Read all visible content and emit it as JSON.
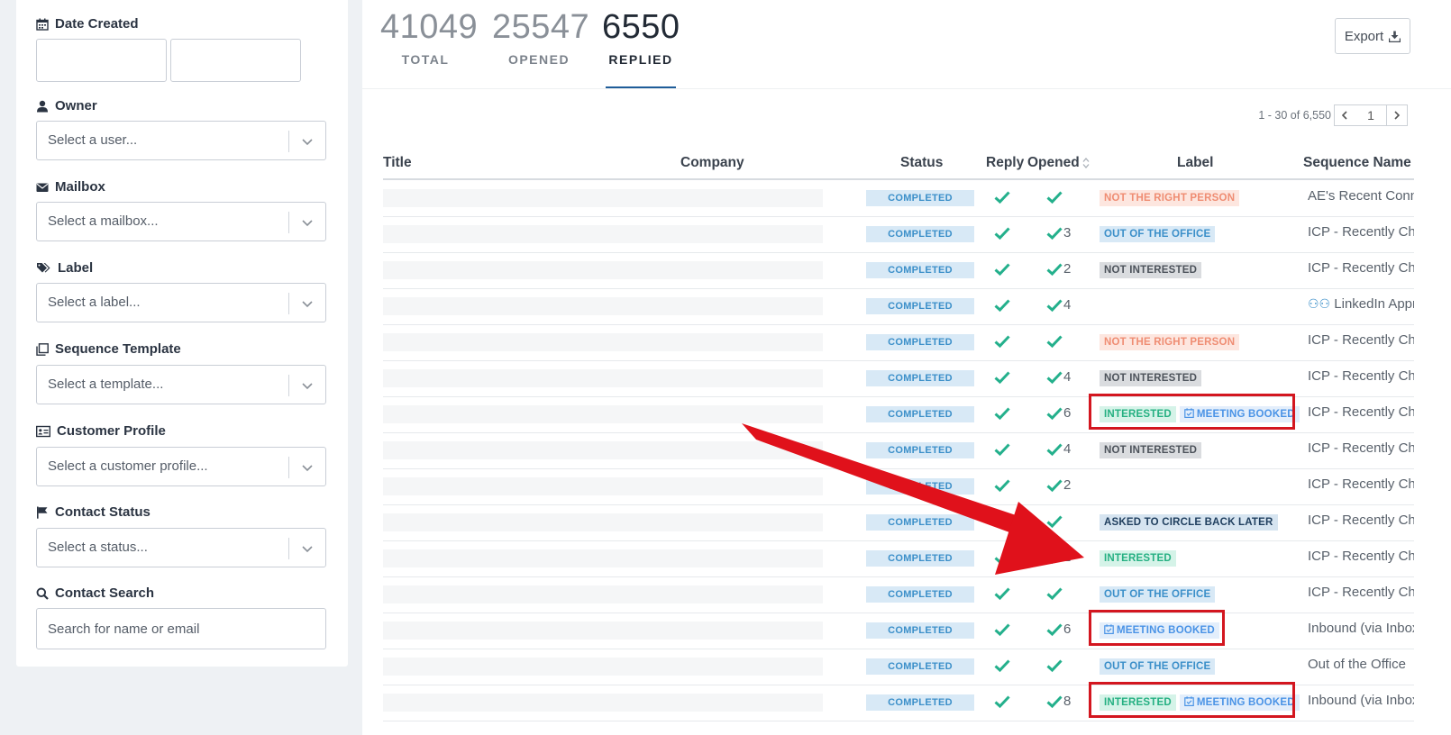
{
  "sidebar": {
    "date_created": {
      "label": "Date Created"
    },
    "owner": {
      "label": "Owner",
      "placeholder": "Select a user..."
    },
    "mailbox": {
      "label": "Mailbox",
      "placeholder": "Select a mailbox..."
    },
    "label": {
      "label": "Label",
      "placeholder": "Select a label..."
    },
    "sequence_template": {
      "label": "Sequence Template",
      "placeholder": "Select a template..."
    },
    "customer_profile": {
      "label": "Customer Profile",
      "placeholder": "Select a customer profile..."
    },
    "contact_status": {
      "label": "Contact Status",
      "placeholder": "Select a status..."
    },
    "contact_search": {
      "label": "Contact Search",
      "placeholder": "Search for name or email"
    }
  },
  "stats": [
    {
      "value": "41049",
      "label": "TOTAL",
      "active": false
    },
    {
      "value": "25547",
      "label": "OPENED",
      "active": false
    },
    {
      "value": "6550",
      "label": "REPLIED",
      "active": true
    }
  ],
  "export_label": "Export",
  "pagination": {
    "range": "1 - 30 of 6,550",
    "page": "1"
  },
  "table": {
    "columns": {
      "title": "Title",
      "company": "Company",
      "status": "Status",
      "reply": "Reply",
      "opened": "Opened",
      "label": "Label",
      "sequence": "Sequence Name"
    },
    "rows": [
      {
        "status": "COMPLETED",
        "opened": "",
        "labels": [
          {
            "text": "NOT THE RIGHT PERSON",
            "kind": "nrp"
          }
        ],
        "sequence": "AE's Recent Connections"
      },
      {
        "status": "COMPLETED",
        "opened": "3",
        "labels": [
          {
            "text": "OUT OF THE OFFICE",
            "kind": "ooo"
          }
        ],
        "sequence": "ICP - Recently Changed"
      },
      {
        "status": "COMPLETED",
        "opened": "2",
        "labels": [
          {
            "text": "NOT INTERESTED",
            "kind": "ni"
          }
        ],
        "sequence": "ICP - Recently Changed"
      },
      {
        "status": "COMPLETED",
        "opened": "4",
        "labels": [],
        "sequence": "👥 LinkedIn Approach"
      },
      {
        "status": "COMPLETED",
        "opened": "",
        "labels": [
          {
            "text": "NOT THE RIGHT PERSON",
            "kind": "nrp"
          }
        ],
        "sequence": "ICP - Recently Changed"
      },
      {
        "status": "COMPLETED",
        "opened": "4",
        "labels": [
          {
            "text": "NOT INTERESTED",
            "kind": "ni"
          }
        ],
        "sequence": "ICP - Recently Changed"
      },
      {
        "status": "COMPLETED",
        "opened": "6",
        "labels": [
          {
            "text": "INTERESTED",
            "kind": "int"
          },
          {
            "text": "MEETING BOOKED",
            "kind": "mb"
          }
        ],
        "sequence": "ICP - Recently Changed",
        "highlight": true
      },
      {
        "status": "COMPLETED",
        "opened": "4",
        "labels": [
          {
            "text": "NOT INTERESTED",
            "kind": "ni"
          }
        ],
        "sequence": "ICP - Recently Changed"
      },
      {
        "status": "COMPLETED",
        "opened": "2",
        "labels": [],
        "sequence": "ICP - Recently Changed"
      },
      {
        "status": "COMPLETED",
        "opened": "",
        "labels": [
          {
            "text": "ASKED TO CIRCLE BACK LATER",
            "kind": "cbl"
          }
        ],
        "sequence": "ICP - Recently Changed"
      },
      {
        "status": "COMPLETED",
        "opened": "2",
        "labels": [
          {
            "text": "INTERESTED",
            "kind": "int"
          }
        ],
        "sequence": "ICP - Recently Changed"
      },
      {
        "status": "COMPLETED",
        "opened": "",
        "labels": [
          {
            "text": "OUT OF THE OFFICE",
            "kind": "ooo"
          }
        ],
        "sequence": "ICP - Recently Changed"
      },
      {
        "status": "COMPLETED",
        "opened": "6",
        "labels": [
          {
            "text": "MEETING BOOKED",
            "kind": "mb"
          }
        ],
        "sequence": "Inbound (via Inbox)",
        "highlight": true
      },
      {
        "status": "COMPLETED",
        "opened": "",
        "labels": [
          {
            "text": "OUT OF THE OFFICE",
            "kind": "ooo"
          }
        ],
        "sequence": "Out of the Office"
      },
      {
        "status": "COMPLETED",
        "opened": "8",
        "labels": [
          {
            "text": "INTERESTED",
            "kind": "int"
          },
          {
            "text": "MEETING BOOKED",
            "kind": "mb"
          }
        ],
        "sequence": "Inbound (via Inbox)",
        "highlight": true
      }
    ]
  },
  "colors": {
    "check": "#24b08c",
    "annotation_red": "#e0111b",
    "nrp_bg": "#fde6df",
    "nrp_fg": "#ef8d73",
    "ooo_bg": "#d8e9f6",
    "ooo_fg": "#3b8fc9",
    "ni_bg": "#dadcdf",
    "ni_fg": "#4d535b",
    "cbl_bg": "#d6e4f0",
    "cbl_fg": "#1f3e5e",
    "int_bg": "#d5f3e8",
    "int_fg": "#25b082",
    "mb_bg": "#e3eefb",
    "mb_fg": "#4a93e6"
  }
}
